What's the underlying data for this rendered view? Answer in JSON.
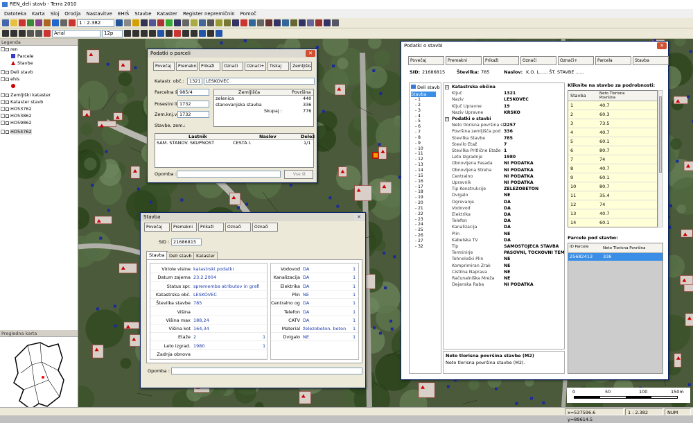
{
  "app": {
    "title": "REN_deli stavb - Terra 2010"
  },
  "menu": [
    "Datoteka",
    "Karta",
    "Sloj",
    "Orodja",
    "Nastavitve",
    "EHIŠ",
    "Stavbe",
    "Kataster",
    "Register nepremičnin",
    "Pomoč"
  ],
  "toolbar": {
    "scale_value": "1 : 2.382",
    "font_name": "Arial",
    "font_size": "12p"
  },
  "legend": {
    "title": "Legenda",
    "items": [
      {
        "label": "ren",
        "indent": 0
      },
      {
        "label": "Parcele",
        "indent": 2
      },
      {
        "label": "Stavbe",
        "indent": 2
      },
      {
        "label": "Deli stavb",
        "indent": 0
      },
      {
        "label": "ehis",
        "indent": 0
      },
      {
        "label": "",
        "indent": 2
      },
      {
        "label": "Zemljiški kataster",
        "indent": 0
      },
      {
        "label": "Kataster stavb",
        "indent": 0
      },
      {
        "label": "HO53762",
        "indent": 0
      },
      {
        "label": "HO53862",
        "indent": 0
      },
      {
        "label": "HO59862",
        "indent": 0
      },
      {
        "label": "HO54762",
        "indent": 0
      }
    ]
  },
  "overview": {
    "title": "Pregledna karta"
  },
  "status": {
    "coords": "x=537596.6 y=89614.5",
    "scale": "1 : 2.382",
    "num": "NUM"
  },
  "scalebar": {
    "ticks": [
      "0",
      "50",
      "100",
      "150m"
    ]
  },
  "parcela": {
    "title": "Podatki o parceli",
    "buttons": [
      "Povečaj",
      "Premakni",
      "Prikaži",
      "Označi",
      "Označi+",
      "Tiskaj",
      "Zemljiška knjiga"
    ],
    "ko_label": "Katastr. obč.:",
    "ko_num": "1321",
    "ko_name": "LESKOVEC",
    "parc_label": "Parcelna št.:",
    "parc_val": "985/4",
    "posv_label": "Posestni list:",
    "posv_val": "1732",
    "zk_label": "Zem.knj.vl.:",
    "zk_val": "1732",
    "stavbe_label": "Stavbe, zem.:",
    "zemljisca_header": [
      "Zemljišča",
      "Površina"
    ],
    "zemljisca": [
      [
        "zelenica",
        "440"
      ],
      [
        "stanovanjska stavba",
        "336"
      ]
    ],
    "skupaj_label": "Skupaj :",
    "skupaj_val": "776",
    "lastnik_header": [
      "Lastnik",
      "Naslov",
      "Delež"
    ],
    "lastnik_row": [
      "SAM. STANOV. SKUPNOST",
      "CESTA I.",
      "1/1"
    ],
    "opomba_label": "Opomba :",
    "vse_label": "Vse št"
  },
  "stavba": {
    "title": "Stavba",
    "buttons": [
      "Povečaj",
      "Premakni",
      "Prikaži",
      "Označi",
      "Označi"
    ],
    "sid_label": "SID :",
    "sid_val": "21686815",
    "tabs": [
      "Stavba",
      "Deli stavb",
      "Kataster"
    ],
    "left_rows": [
      [
        "Vir/ole visine",
        "katastrski podatki",
        ""
      ],
      [
        "Datum zajema",
        "23.2.2004",
        ""
      ],
      [
        "Status spr.",
        "sprememba atributov in grafike",
        ""
      ],
      [
        "Katastrska obč.",
        "LESKOVEC",
        ""
      ],
      [
        "Številka stavbe",
        "785",
        ""
      ],
      [
        "Višina",
        "",
        ""
      ],
      [
        "Višina max",
        "188,24",
        ""
      ],
      [
        "Višina kot",
        "164,34",
        ""
      ],
      [
        "Etaže",
        "2",
        "1"
      ],
      [
        "Leto izgrad.",
        "1980",
        "1"
      ],
      [
        "Zadnja obnova",
        "",
        ""
      ]
    ],
    "right_rows": [
      [
        "Vodovod",
        "DA",
        "1"
      ],
      [
        "Kanalizacija",
        "DA",
        "1"
      ],
      [
        "Elektrika",
        "DA",
        "1"
      ],
      [
        "Plin",
        "NE",
        "1"
      ],
      [
        "Centralno ogr.",
        "DA",
        "1"
      ],
      [
        "Telefon",
        "DA",
        "1"
      ],
      [
        "CATV",
        "DA",
        "1"
      ],
      [
        "Material",
        "železobeton, beton",
        "1"
      ],
      [
        "Dvigalo",
        "NE",
        "1"
      ]
    ],
    "opomba_label": "Opomba :"
  },
  "podatki": {
    "title": "Podatki o stavbi",
    "buttons": [
      "Povečaj",
      "Premakni",
      "Prikaži",
      "Označi",
      "Označi+",
      "Parcela",
      "Stavba"
    ],
    "sid_label": "SID:",
    "sid_val": "21686815",
    "stev_label": "Številka:",
    "stev_val": "785",
    "naslov_label": "Naslov:",
    "naslov_val": "K.O. L...... ŠT. STAVBE ......",
    "tree_root": "Deli stavb",
    "tree_sel": "Stavba",
    "tree_items": [
      "1",
      "2",
      "3",
      "4",
      "5",
      "6",
      "7",
      "8",
      "9",
      "10",
      "11",
      "12",
      "13",
      "14",
      "15",
      "16",
      "17",
      "18",
      "19",
      "20",
      "21",
      "22",
      "23",
      "24",
      "25",
      "26",
      "27",
      "32"
    ],
    "props": [
      [
        "Katastrska občina",
        "",
        true
      ],
      [
        "Ključ",
        "1321",
        false
      ],
      [
        "Naziv",
        "LESKOVEC",
        false
      ],
      [
        "Ključ Upravne",
        "19",
        false
      ],
      [
        "Naziv Upravne",
        "KRŠKO",
        false
      ],
      [
        "Podatki o stavbi",
        "",
        true
      ],
      [
        "Neto tlorisna površina st",
        "2257",
        false
      ],
      [
        "Površina zemljišča pod",
        "336",
        false
      ],
      [
        "Številka Stavbe",
        "785",
        false
      ],
      [
        "Število Etaž",
        "7",
        false
      ],
      [
        "Številka Pritlične Etaže",
        "1",
        false
      ],
      [
        "Leto Izgradnje",
        "1980",
        false
      ],
      [
        "Obnovljena Fasada",
        "NI PODATKA",
        false
      ],
      [
        "Obnovljena Streha",
        "NI PODATKA",
        false
      ],
      [
        "Centralno",
        "NI PODATKA",
        false
      ],
      [
        "Upravnik",
        "NI PODATKA",
        false
      ],
      [
        "Tip Konstrukcije",
        "ŽELEZOBETON",
        false
      ],
      [
        "Dvigalo",
        "NE",
        false
      ],
      [
        "Ogrevanje",
        "DA",
        false
      ],
      [
        "Vodovod",
        "DA",
        false
      ],
      [
        "Elektrika",
        "DA",
        false
      ],
      [
        "Telefon",
        "DA",
        false
      ],
      [
        "Kanalizacija",
        "DA",
        false
      ],
      [
        "Plin",
        "NE",
        false
      ],
      [
        "Kabelska TV",
        "DA",
        false
      ],
      [
        "Tip",
        "SAMOSTOJEČA STAVBA",
        false
      ],
      [
        "Terminirje",
        "PASOVNI, TOČKOVNI TEM",
        false
      ],
      [
        "Tehnološki Plin",
        "NE",
        false
      ],
      [
        "Komprimiran Zrak",
        "NE",
        false
      ],
      [
        "Čistilna Naprava",
        "NE",
        false
      ],
      [
        "Računalniška Mreža",
        "NE",
        false
      ],
      [
        "Dejanska Raba",
        "NI PODATKA",
        false
      ]
    ],
    "desc_title": "Neto tlorisna površina stavbe (M2)",
    "desc_text": "Neto tlorisna površina stavbe (M2).",
    "right_title": "Kliknite na stavbo za podrobnosti:",
    "table_header": [
      "Stavba",
      "Neto Tlorisna Površina"
    ],
    "table_rows": [
      [
        "1",
        "40.7"
      ],
      [
        "2",
        "60.3"
      ],
      [
        "3",
        "73.5"
      ],
      [
        "4",
        "40.7"
      ],
      [
        "5",
        "60.1"
      ],
      [
        "6",
        "80.7"
      ],
      [
        "7",
        "74"
      ],
      [
        "8",
        "40.7"
      ],
      [
        "9",
        "60.1"
      ],
      [
        "10",
        "80.7"
      ],
      [
        "11",
        "35.4"
      ],
      [
        "12",
        "74"
      ],
      [
        "13",
        "40.7"
      ],
      [
        "14",
        "60.1"
      ]
    ],
    "parcele_title": "Parcele pod stavbo:",
    "parcele_header": [
      "ID Parcele",
      "Neto Tlorisna Površina"
    ],
    "parcele_rows": [
      [
        "25682413",
        "336"
      ]
    ]
  }
}
